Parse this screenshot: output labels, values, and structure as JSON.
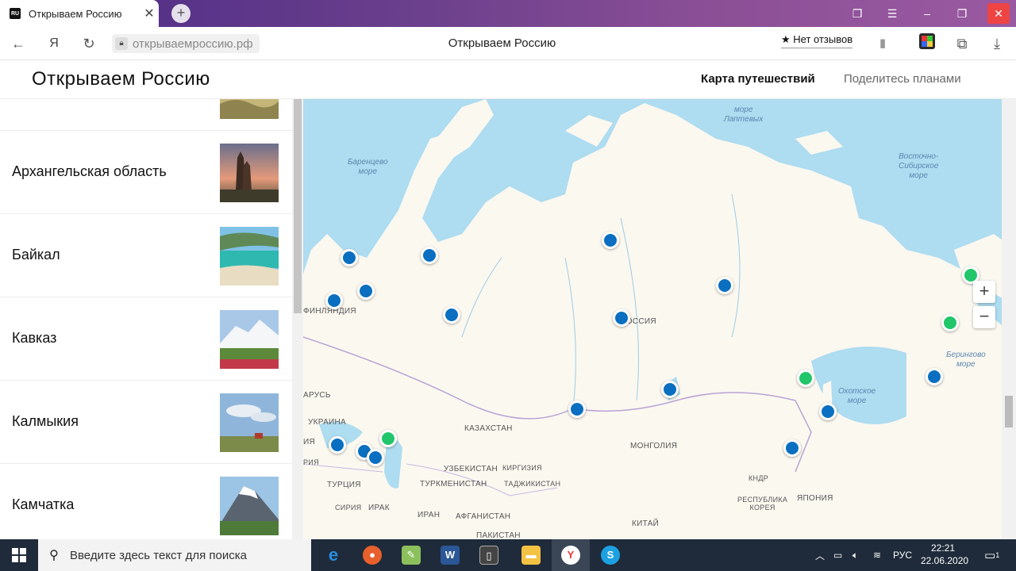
{
  "browser": {
    "tab_title": "Открываем Россию",
    "tab_favicon": "RU",
    "url": "открываемроссию.рф",
    "page_title": "Открываем Россию",
    "reviews_label": "Нет отзывов"
  },
  "site": {
    "logo": "Открываем Россию",
    "nav": [
      "Карта путешествий",
      "Поделитесь планами"
    ]
  },
  "regions": [
    {
      "name": ""
    },
    {
      "name": "Архангельская область"
    },
    {
      "name": "Байкал"
    },
    {
      "name": "Кавказ"
    },
    {
      "name": "Калмыкия"
    },
    {
      "name": "Камчатка"
    }
  ],
  "map": {
    "seas": [
      {
        "name": "море\nЛаптевых"
      },
      {
        "name": "Баренцево\nморе"
      },
      {
        "name": "Восточно-\nСибирское\nморе"
      },
      {
        "name": "Берингово\nморе"
      },
      {
        "name": "Охотское\nморе"
      }
    ],
    "countries": [
      "ФИНЛЯНДИЯ",
      "РОССИЯ",
      "АРУСЬ",
      "УКРАИНА",
      "ИЯ",
      "РИЯ",
      "ТУРЦИЯ",
      "СИРИЯ",
      "ИРАК",
      "ИРАН",
      "КАЗАХСТАН",
      "УЗБЕКИСТАН",
      "КИРГИЗИЯ",
      "ТУРКМЕНИСТАН",
      "ТАДЖИКИСТАН",
      "АФГАНИСТАН",
      "ПАКИСТАН",
      "МОНГОЛИЯ",
      "КИТАЙ",
      "КНДР",
      "РЕСПУБЛИКА\nКОРЕЯ",
      "ЯПОНИЯ"
    ],
    "zoom_in": "+",
    "zoom_out": "−",
    "marker_colors": {
      "visited": "#0a6fc0",
      "planned": "#22c66a"
    }
  },
  "taskbar": {
    "search_placeholder": "Введите здесь текст для поиска",
    "lang": "РУС",
    "time": "22:21",
    "date": "22.06.2020",
    "notifications": "1"
  }
}
